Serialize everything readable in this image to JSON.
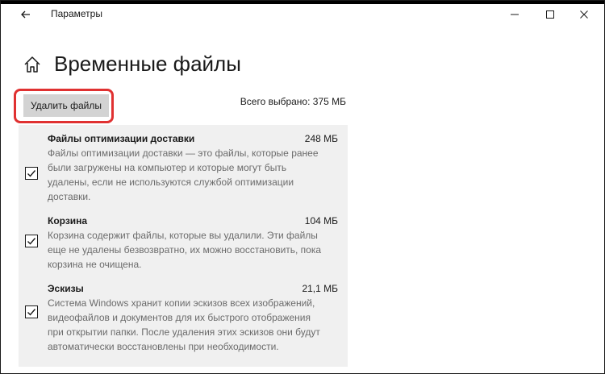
{
  "window": {
    "title": "Параметры",
    "back_icon": "arrow-left-icon",
    "controls": [
      "minimize-icon",
      "maximize-icon",
      "close-icon"
    ]
  },
  "page": {
    "title": "Временные файлы",
    "home_icon": "home-icon"
  },
  "actions": {
    "delete_label": "Удалить файлы",
    "total_selected": "Всего выбрано: 375 МБ",
    "highlight_color": "#e03131"
  },
  "items": [
    {
      "name": "Файлы оптимизации доставки",
      "size": "248 МБ",
      "description": "Файлы оптимизации доставки — это файлы, которые ранее были загружены на компьютер и которые могут быть удалены, если не используются службой оптимизации доставки.",
      "checked": true
    },
    {
      "name": "Корзина",
      "size": "104 МБ",
      "description": "Корзина содержит файлы, которые вы удалили. Эти файлы еще не удалены безвозвратно, их можно восстановить, пока корзина не очищена.",
      "checked": true
    },
    {
      "name": "Эскизы",
      "size": "21,1 МБ",
      "description": "Система Windows хранит копии эскизов всех изображений, видеофайлов и документов для их быстрого отображения при открытии папки. После удаления этих эскизов они будут автоматически восстановлены при необходимости.",
      "checked": true
    }
  ]
}
